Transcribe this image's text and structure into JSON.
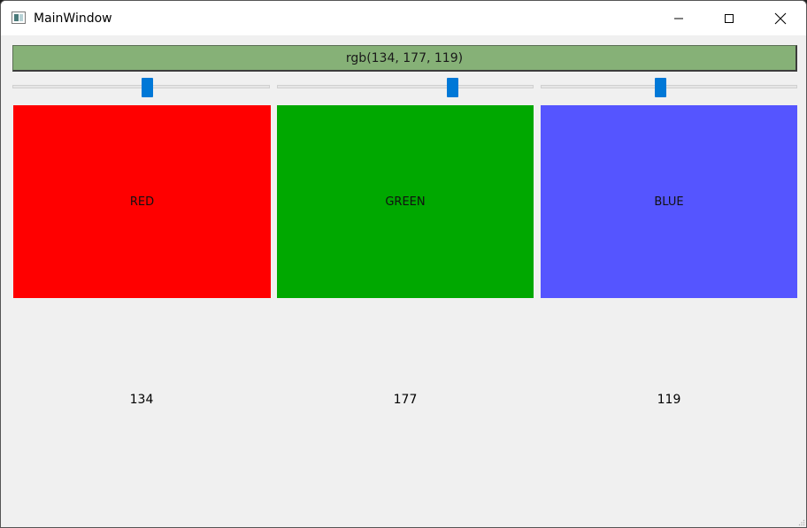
{
  "window": {
    "title": "MainWindow",
    "icons": {
      "app": "app-window-icon",
      "minimize": "minimize-icon",
      "maximize": "maximize-icon",
      "close": "close-icon"
    }
  },
  "preview": {
    "label": "rgb(134, 177, 119)",
    "color": "#86b177"
  },
  "sliders": [
    {
      "channel": "red",
      "value": 134,
      "max": 255
    },
    {
      "channel": "green",
      "value": 177,
      "max": 255
    },
    {
      "channel": "blue",
      "value": 119,
      "max": 255
    }
  ],
  "swatches": [
    {
      "label": "RED",
      "color": "#ff0000"
    },
    {
      "label": "GREEN",
      "color": "#00a800"
    },
    {
      "label": "BLUE",
      "color": "#5555ff"
    }
  ],
  "values": [
    "134",
    "177",
    "119"
  ],
  "accent": "#0078d7"
}
